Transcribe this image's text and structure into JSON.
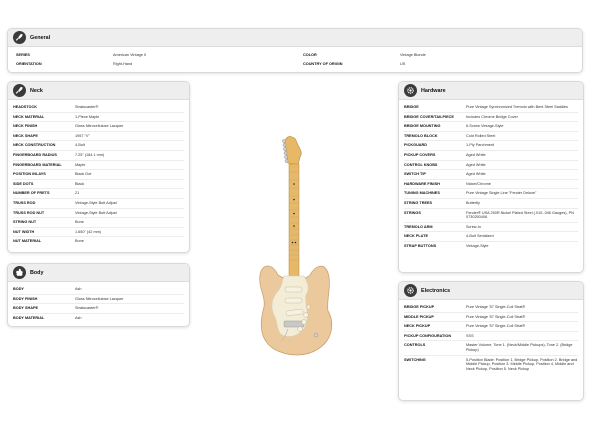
{
  "general": {
    "title": "General",
    "rows": [
      {
        "label": "SERIES",
        "value": "American Vintage II"
      },
      {
        "label": "ORIENTATION",
        "value": "Right-Hand"
      },
      {
        "label": "COLOR",
        "value": "Vintage Blonde"
      },
      {
        "label": "COUNTRY OF ORIGIN",
        "value": "US"
      }
    ]
  },
  "neck": {
    "title": "Neck",
    "rows": [
      {
        "label": "HEADSTOCK",
        "value": "Stratocaster®"
      },
      {
        "label": "NECK MATERIAL",
        "value": "1-Piece Maple"
      },
      {
        "label": "NECK FINISH",
        "value": "Gloss Nitrocellulose Lacquer"
      },
      {
        "label": "NECK SHAPE",
        "value": "1957 \"V\""
      },
      {
        "label": "NECK CONSTRUCTION",
        "value": "4-Bolt"
      },
      {
        "label": "FINGERBOARD RADIUS",
        "value": "7.25\" (184.1 mm)"
      },
      {
        "label": "FINGERBOARD MATERIAL",
        "value": "Maple"
      },
      {
        "label": "POSITION INLAYS",
        "value": "Black Dot"
      },
      {
        "label": "SIDE DOTS",
        "value": "Black"
      },
      {
        "label": "NUMBER OF FRETS",
        "value": "21"
      },
      {
        "label": "TRUSS ROD",
        "value": "Vintage-Style Butt Adjust"
      },
      {
        "label": "TRUSS ROD NUT",
        "value": "Vintage-Style Butt Adjust"
      },
      {
        "label": "STRING NUT",
        "value": "Bone"
      },
      {
        "label": "NUT WIDTH",
        "value": "1.650\" (42 mm)"
      },
      {
        "label": "NUT MATERIAL",
        "value": "Bone"
      }
    ]
  },
  "body": {
    "title": "Body",
    "rows": [
      {
        "label": "BODY",
        "value": "Ash"
      },
      {
        "label": "BODY FINISH",
        "value": "Gloss Nitrocellulose Lacquer"
      },
      {
        "label": "BODY SHAPE",
        "value": "Stratocaster®"
      },
      {
        "label": "BODY MATERIAL",
        "value": "Ash"
      }
    ]
  },
  "hardware": {
    "title": "Hardware",
    "rows": [
      {
        "label": "BRIDGE",
        "value": "Pure Vintage Synchronized Tremolo with Bent Steel Saddles"
      },
      {
        "label": "BRIDGE COVER/TAILPIECE",
        "value": "Includes Chrome Bridge Cover"
      },
      {
        "label": "BRIDGE MOUNTING",
        "value": "6-Screw Vintage-Style"
      },
      {
        "label": "TREMOLO BLOCK",
        "value": "Cold Rolled Steel"
      },
      {
        "label": "PICKGUARD",
        "value": "1-Ply Parchment"
      },
      {
        "label": "PICKUP COVERS",
        "value": "Aged White"
      },
      {
        "label": "CONTROL KNOBS",
        "value": "Aged White"
      },
      {
        "label": "SWITCH TIP",
        "value": "Aged White"
      },
      {
        "label": "HARDWARE FINISH",
        "value": "Nickel/Chrome"
      },
      {
        "label": "TUNING MACHINES",
        "value": "Pure Vintage Single Line \"Fender Deluxe\""
      },
      {
        "label": "STRING TREES",
        "value": "Butterfly"
      },
      {
        "label": "STRINGS",
        "value": "Fender® USA 250R Nickel Plated Steel (.010-.046 Gauges), PN 0730250406"
      },
      {
        "label": "TREMOLO ARM",
        "value": "Screw-In"
      },
      {
        "label": "NECK PLATE",
        "value": "4-Bolt Serialized"
      },
      {
        "label": "STRAP BUTTONS",
        "value": "Vintage-Style"
      }
    ]
  },
  "electronics": {
    "title": "Electronics",
    "rows": [
      {
        "label": "BRIDGE PICKUP",
        "value": "Pure Vintage '57 Single-Coil Strat®"
      },
      {
        "label": "MIDDLE PICKUP",
        "value": "Pure Vintage '57 Single-Coil Strat®"
      },
      {
        "label": "NECK PICKUP",
        "value": "Pure Vintage '57 Single-Coil Strat®"
      },
      {
        "label": "PICKUP CONFIGURATION",
        "value": "SSS"
      },
      {
        "label": "CONTROLS",
        "value": "Master Volume, Tone 1. (Neck/Middle Pickups), Tone 2. (Bridge Pickup)"
      },
      {
        "label": "SWITCHING",
        "value": "5-Position Blade: Position 1. Bridge Pickup, Position 2. Bridge and Middle Pickup, Position 3. Middle Pickup, Position 4. Middle and Neck Pickup, Position 5. Neck Pickup"
      }
    ]
  },
  "icons": {
    "general": "guitar-headstock-icon",
    "neck": "guitar-headstock-icon",
    "body": "guitar-body-icon",
    "hardware": "gear-icon",
    "electronics": "gear-icon"
  },
  "colors": {
    "header_bg": "#eeeeee",
    "icon_bg": "#3a3a3a",
    "guitar_body": "#ecc99c",
    "pickguard": "#f3ecd6",
    "neck_maple": "#e7b866"
  }
}
